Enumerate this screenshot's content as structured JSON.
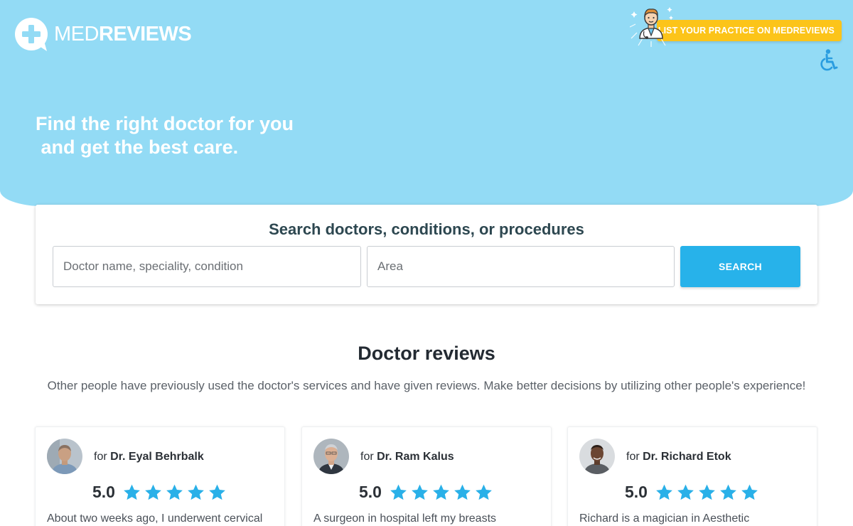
{
  "brand": {
    "logo_light": "MED",
    "logo_bold": "REVIEWS",
    "logo_icon": "plus-speech-bubble-icon"
  },
  "header": {
    "list_practice_label": "LIST YOUR PRACTICE ON MEDREVIEWS",
    "doctor_badge_icon": "doctor-icon",
    "accessibility_icon": "wheelchair-icon"
  },
  "hero": {
    "title_line1": "Find the right doctor for you",
    "title_line2": " and get the best care."
  },
  "search": {
    "title": "Search doctors, conditions, or procedures",
    "doctor_placeholder": "Doctor name, speciality, condition",
    "area_placeholder": "Area",
    "button_label": "SEARCH"
  },
  "reviews": {
    "title": "Doctor reviews",
    "subtitle": "Other people have previously used the doctor's services and have given reviews. Make better decisions by utilizing other people's experience!",
    "items": [
      {
        "for_label": "for",
        "doctor": "Dr. Eyal Behrbalk",
        "score": "5.0",
        "stars": 5,
        "excerpt": "About two weeks ago, I underwent cervical"
      },
      {
        "for_label": "for",
        "doctor": "Dr. Ram Kalus",
        "score": "5.0",
        "stars": 5,
        "excerpt": "A surgeon in hospital left my breasts"
      },
      {
        "for_label": "for",
        "doctor": "Dr. Richard Etok",
        "score": "5.0",
        "stars": 5,
        "excerpt": "Richard is a magician in Aesthetic"
      }
    ]
  },
  "colors": {
    "hero_bg": "#93dbf5",
    "accent_blue": "#27b2ea",
    "cta_yellow": "#fcc419",
    "star_blue": "#29b0e8"
  }
}
